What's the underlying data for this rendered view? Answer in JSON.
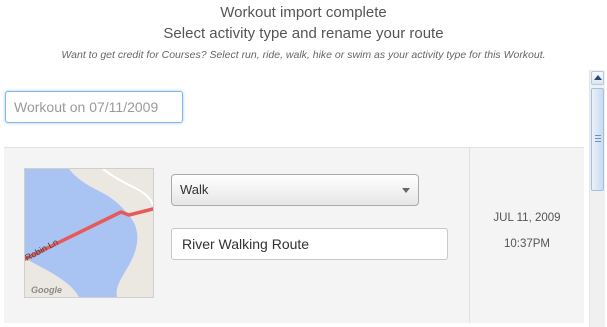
{
  "header": {
    "line1": "Workout import complete",
    "line2": "Select activity type and rename your route",
    "hint": "Want to get credit for Courses? Select run, ride, walk, hike or swim as your activity type for this Workout."
  },
  "workout_name": {
    "placeholder": "Workout on 07/11/2009"
  },
  "route_row": {
    "activity_type": "Walk",
    "route_name": "River Walking Route",
    "date": "JUL 11, 2009",
    "time": "10:37PM",
    "map": {
      "street_label": "Robin Ln",
      "attribution": "Google",
      "route_color": "#e85a5a",
      "water_color": "#a9c4f2"
    }
  }
}
